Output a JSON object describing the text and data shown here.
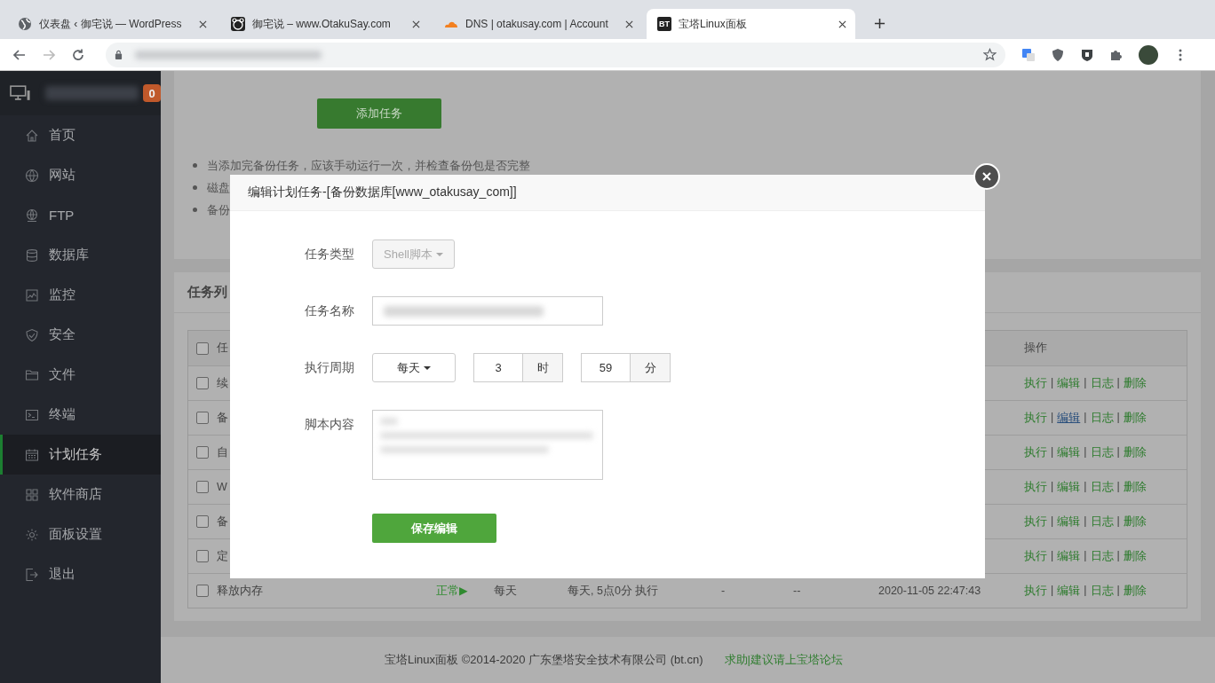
{
  "browser": {
    "tabs": [
      {
        "title": "仪表盘 ‹ 御宅说 — WordPress",
        "selected": false
      },
      {
        "title": "御宅说 – www.OtakuSay.com",
        "selected": false
      },
      {
        "title": "DNS | otakusay.com | Account",
        "selected": false
      },
      {
        "title": "宝塔Linux面板",
        "selected": true,
        "logo": "BT"
      }
    ]
  },
  "sidebar": {
    "badge": "0",
    "items": [
      {
        "label": "首页",
        "selected": false
      },
      {
        "label": "网站",
        "selected": false
      },
      {
        "label": "FTP",
        "selected": false
      },
      {
        "label": "数据库",
        "selected": false
      },
      {
        "label": "监控",
        "selected": false
      },
      {
        "label": "安全",
        "selected": false
      },
      {
        "label": "文件",
        "selected": false
      },
      {
        "label": "终端",
        "selected": false
      },
      {
        "label": "计划任务",
        "selected": true
      },
      {
        "label": "软件商店",
        "selected": false
      },
      {
        "label": "面板设置",
        "selected": false
      },
      {
        "label": "退出",
        "selected": false
      }
    ]
  },
  "add_button": "添加任务",
  "notes": [
    "当添加完备份任务，应该手动运行一次，并检查备份包是否完整",
    "磁盘",
    "备份"
  ],
  "task_list": {
    "title": "任务列",
    "columns": [
      "任",
      "操作"
    ],
    "all_checked": false,
    "action_separator": "|",
    "rows": [
      {
        "name": "续",
        "checked": false,
        "actions": [
          {
            "label": "执行",
            "hovered": false
          },
          {
            "label": "编辑",
            "hovered": false
          },
          {
            "label": "日志",
            "hovered": false
          },
          {
            "label": "删除",
            "hovered": false
          }
        ]
      },
      {
        "name": "备",
        "checked": false,
        "actions": [
          {
            "label": "执行",
            "hovered": false
          },
          {
            "label": "编辑",
            "hovered": true
          },
          {
            "label": "日志",
            "hovered": false
          },
          {
            "label": "删除",
            "hovered": false
          }
        ]
      },
      {
        "name": "自",
        "checked": false,
        "actions": [
          {
            "label": "执行",
            "hovered": false
          },
          {
            "label": "编辑",
            "hovered": false
          },
          {
            "label": "日志",
            "hovered": false
          },
          {
            "label": "删除",
            "hovered": false
          }
        ]
      },
      {
        "name": "W",
        "checked": false,
        "actions": [
          {
            "label": "执行",
            "hovered": false
          },
          {
            "label": "编辑",
            "hovered": false
          },
          {
            "label": "日志",
            "hovered": false
          },
          {
            "label": "删除",
            "hovered": false
          }
        ]
      },
      {
        "name": "备",
        "checked": false,
        "actions": [
          {
            "label": "执行",
            "hovered": false
          },
          {
            "label": "编辑",
            "hovered": false
          },
          {
            "label": "日志",
            "hovered": false
          },
          {
            "label": "删除",
            "hovered": false
          }
        ]
      },
      {
        "name": "定",
        "checked": false,
        "actions": [
          {
            "label": "执行",
            "hovered": false
          },
          {
            "label": "编辑",
            "hovered": false
          },
          {
            "label": "日志",
            "hovered": false
          },
          {
            "label": "删除",
            "hovered": false
          }
        ]
      },
      {
        "name": "释放内存",
        "checked": false,
        "status": "正常▶",
        "cycle": "每天",
        "exec_time": "每天, 5点0分 执行",
        "column_5": "-",
        "column_6": "--",
        "date": "2020-11-05 22:47:43",
        "actions": [
          {
            "label": "执行",
            "hovered": false
          },
          {
            "label": "编辑",
            "hovered": false
          },
          {
            "label": "日志",
            "hovered": false
          },
          {
            "label": "删除",
            "hovered": false
          }
        ]
      }
    ]
  },
  "dialog": {
    "title": "编辑计划任务-[备份数据库[www_otakusay_com]]",
    "fields": [
      {
        "kind": "select",
        "label": "任务类型",
        "value": "Shell脚本",
        "disabled": true
      },
      {
        "kind": "text",
        "label": "任务名称"
      },
      {
        "kind": "cycle",
        "label": "执行周期",
        "period": "每天",
        "hour": "3",
        "hour_unit": "时",
        "minute": "59",
        "minute_unit": "分"
      },
      {
        "kind": "textarea",
        "label": "脚本内容"
      }
    ],
    "save_button": "保存编辑"
  },
  "footer": {
    "copyright": "宝塔Linux面板 ©2014-2020 广东堡塔安全技术有限公司 (bt.cn)",
    "link": "求助|建议请上宝塔论坛"
  }
}
